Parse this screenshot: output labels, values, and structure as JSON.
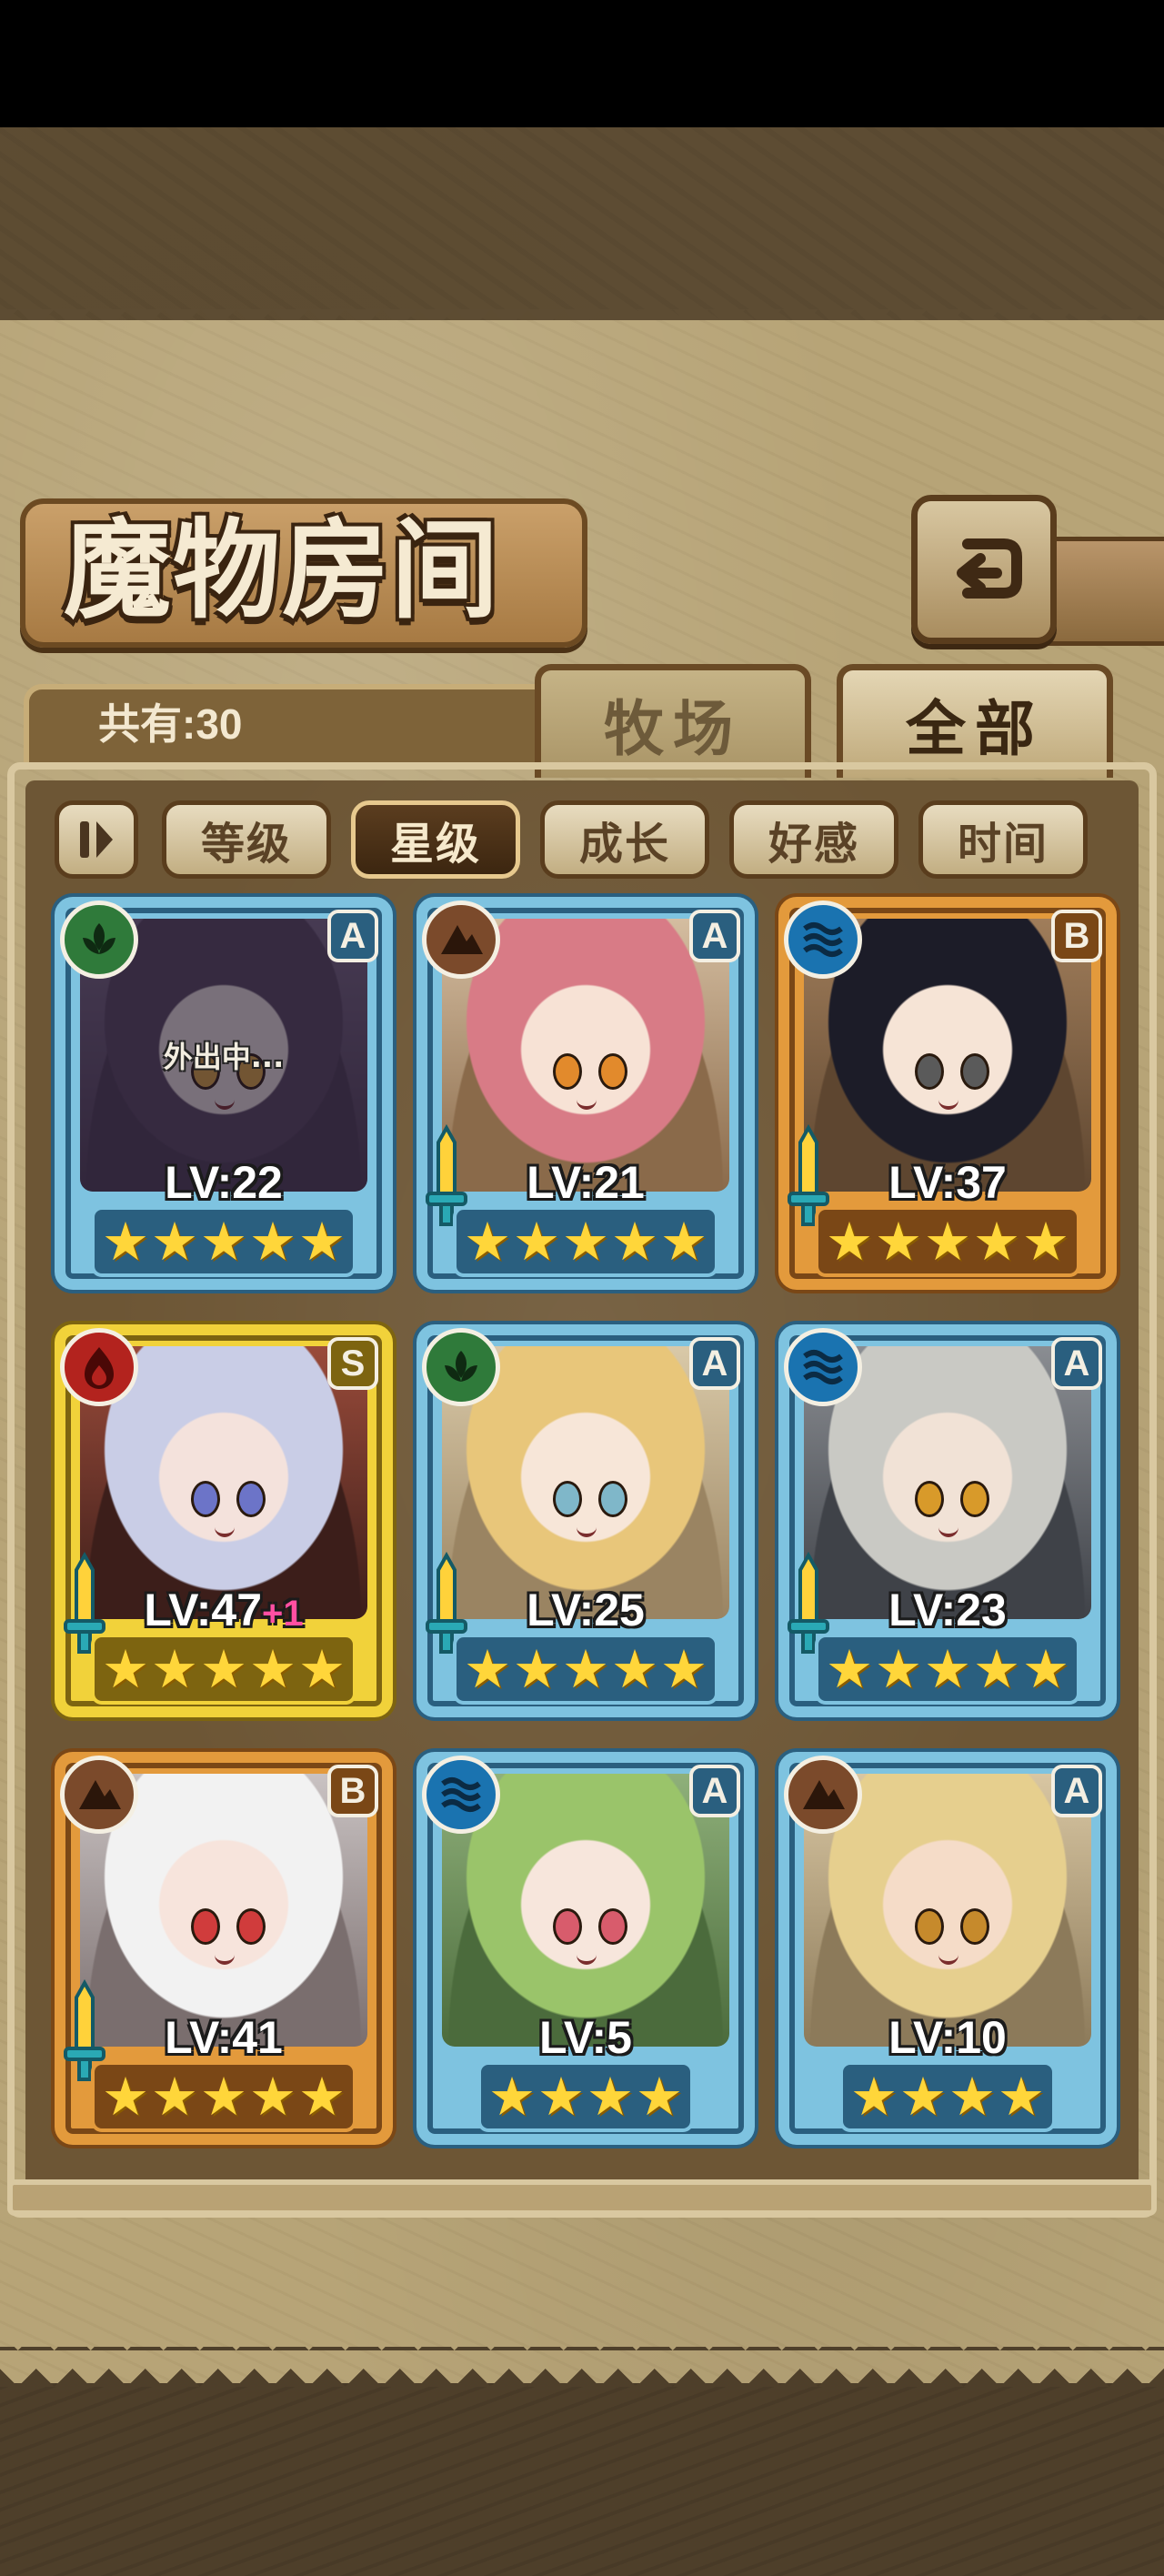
{
  "header": {
    "title": "魔物房间"
  },
  "tabs": {
    "count_label": "共有:30",
    "items": [
      {
        "label": "牧场",
        "active": false
      },
      {
        "label": "全部",
        "active": true
      }
    ]
  },
  "sort": {
    "buttons": [
      {
        "label": "等级",
        "selected": false
      },
      {
        "label": "星级",
        "selected": true
      },
      {
        "label": "成长",
        "selected": false
      },
      {
        "label": "好感",
        "selected": false
      },
      {
        "label": "时间",
        "selected": false
      }
    ]
  },
  "monsters": [
    {
      "rank": "A",
      "element": "nature-icon",
      "level": "LV:22",
      "bonus": "",
      "stars": 5,
      "frame": "blue",
      "status": "外出中...",
      "weapon": false
    },
    {
      "rank": "A",
      "element": "earth-icon",
      "level": "LV:21",
      "bonus": "",
      "stars": 5,
      "frame": "blue",
      "status": "",
      "weapon": true
    },
    {
      "rank": "B",
      "element": "water-icon",
      "level": "LV:37",
      "bonus": "",
      "stars": 5,
      "frame": "orange",
      "status": "",
      "weapon": true
    },
    {
      "rank": "S",
      "element": "fire-icon",
      "level": "LV:47",
      "bonus": "+1",
      "stars": 5,
      "frame": "gold",
      "status": "",
      "weapon": true
    },
    {
      "rank": "A",
      "element": "nature-icon",
      "level": "LV:25",
      "bonus": "",
      "stars": 5,
      "frame": "blue",
      "status": "",
      "weapon": true
    },
    {
      "rank": "A",
      "element": "water-icon",
      "level": "LV:23",
      "bonus": "",
      "stars": 5,
      "frame": "blue",
      "status": "",
      "weapon": true
    },
    {
      "rank": "B",
      "element": "earth-icon",
      "level": "LV:41",
      "bonus": "",
      "stars": 5,
      "frame": "orange",
      "status": "",
      "weapon": true
    },
    {
      "rank": "A",
      "element": "water-icon",
      "level": "LV:5",
      "bonus": "",
      "stars": 4,
      "frame": "blue",
      "status": "",
      "weapon": false
    },
    {
      "rank": "A",
      "element": "earth-icon",
      "level": "LV:10",
      "bonus": "",
      "stars": 4,
      "frame": "blue",
      "status": "",
      "weapon": false
    }
  ],
  "colors": {
    "frame_blue": "#7ec3e0",
    "frame_blue_dark": "#2a5f7f",
    "frame_orange": "#e39a3c",
    "frame_orange_dark": "#7a4716",
    "frame_gold": "#f1d23a",
    "frame_gold_dark": "#7d6410",
    "star": "#ffd63a"
  }
}
